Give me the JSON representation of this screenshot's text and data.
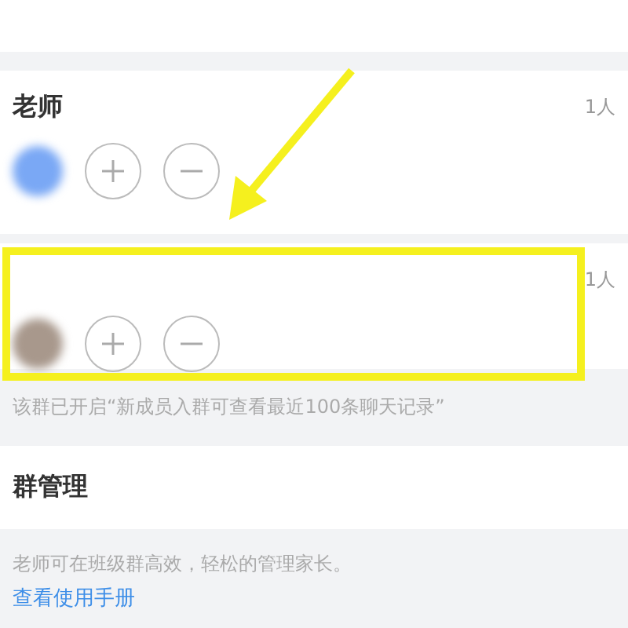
{
  "groups": [
    {
      "title": "老师",
      "count": "1人"
    },
    {
      "count": "1人"
    }
  ],
  "notice": "该群已开启“新成员入群可查看最近100条聊天记录”",
  "management": {
    "title": "群管理",
    "description": "老师可在班级群高效，轻松的管理家长。",
    "link": "查看使用手册"
  }
}
